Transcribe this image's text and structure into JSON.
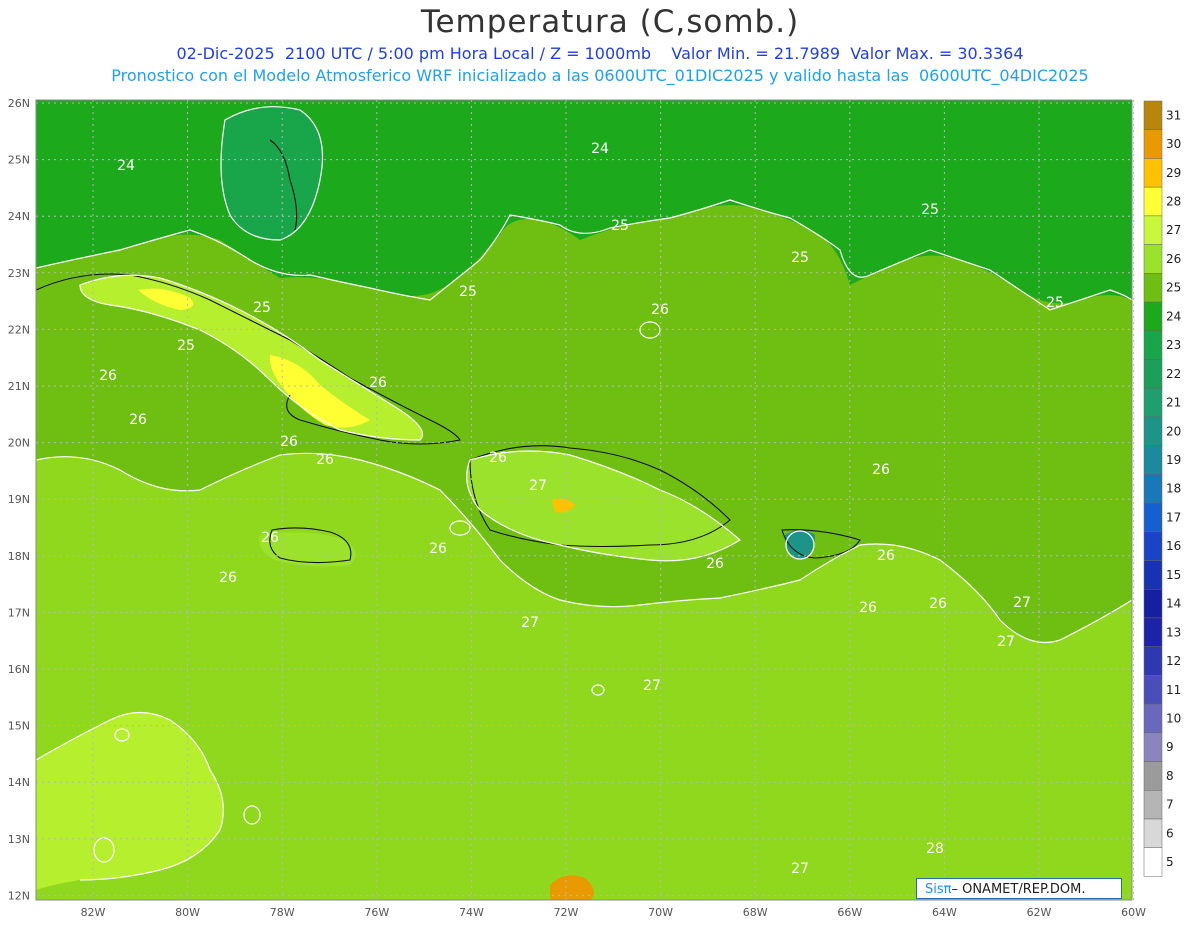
{
  "header": {
    "title": "Temperatura (C,somb.)",
    "line1": "02-Dic-2025  2100 UTC / 5:00 pm Hora Local / Z = 1000mb    Valor Min. = 21.7989  Valor Max. = 30.3364",
    "line2": "Pronostico con el Modelo Atmosferico WRF inicializado a las 0600UTC_01DIC2025 y valido hasta las  0600UTC_04DIC2025"
  },
  "axes": {
    "lat_labels": [
      "26N",
      "25N",
      "24N",
      "23N",
      "22N",
      "21N",
      "20N",
      "19N",
      "18N",
      "17N",
      "16N",
      "15N",
      "14N",
      "13N",
      "12N"
    ],
    "lon_labels": [
      "82W",
      "80W",
      "78W",
      "76W",
      "74W",
      "72W",
      "70W",
      "68W",
      "66W",
      "64W",
      "62W",
      "60W"
    ]
  },
  "colorbar": {
    "labels": [
      "31",
      "30",
      "29",
      "28",
      "27",
      "26",
      "25",
      "24",
      "23",
      "22",
      "21",
      "20",
      "19",
      "18",
      "17",
      "16",
      "15",
      "14",
      "13",
      "12",
      "11",
      "10",
      "9",
      "8",
      "7",
      "6",
      "5"
    ],
    "colors": [
      "#b8860b",
      "#e89a00",
      "#ffc200",
      "#ffff33",
      "#c8f73c",
      "#9be22c",
      "#6fbf12",
      "#1ca91c",
      "#19a64a",
      "#1c9f5a",
      "#1f9f70",
      "#1d9488",
      "#1a8a9c",
      "#1878b8",
      "#1560d0",
      "#1a44c8",
      "#1832b4",
      "#1420a0",
      "#1e22a8",
      "#2f38b0",
      "#4a4eb8",
      "#6a68bc",
      "#8c84bc",
      "#9b9b9b",
      "#b5b5b5",
      "#d8d8d8",
      "#ffffff"
    ]
  },
  "contour_labels": [
    "24",
    "24",
    "25",
    "25",
    "25",
    "25",
    "25",
    "25",
    "25",
    "26",
    "26",
    "26",
    "26",
    "26",
    "26",
    "26",
    "26",
    "26",
    "26",
    "26",
    "26",
    "26",
    "26",
    "26",
    "27",
    "27",
    "27",
    "27",
    "28",
    "27",
    "27"
  ],
  "credit": {
    "sis": "Sisπ",
    "rest": "– ONAMET/REP.DOM."
  }
}
